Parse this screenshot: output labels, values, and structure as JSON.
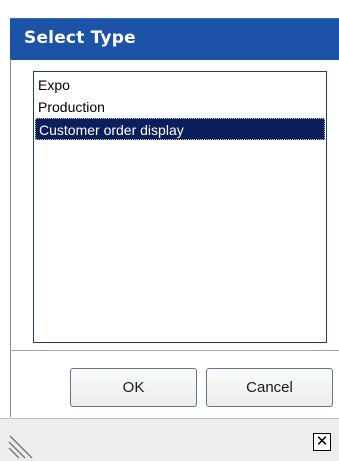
{
  "dialog": {
    "title": "Select Type",
    "list_items": [
      {
        "label": "Expo",
        "selected": false
      },
      {
        "label": "Production",
        "selected": false
      },
      {
        "label": "Customer order display",
        "selected": true
      }
    ],
    "ok_label": "OK",
    "cancel_label": "Cancel"
  },
  "status_bar": {
    "close_glyph": "✕",
    "resize_icon": "resize-grip-icon"
  },
  "colors": {
    "titlebar": "#1c53a6",
    "selection": "#0a1f5b",
    "list_border": "#203a74"
  }
}
